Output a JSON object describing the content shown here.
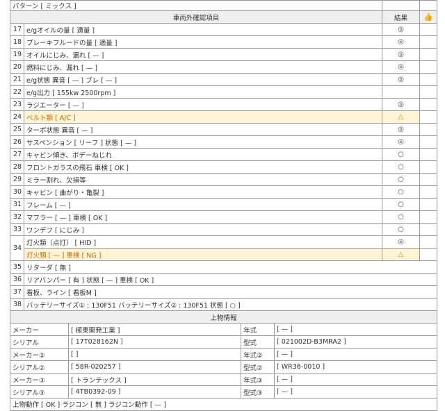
{
  "pattern_row": "パターン [ ミックス ]",
  "header": {
    "title": "車両外確認項目",
    "result_label": "結果",
    "icon": "thumb-up-icon"
  },
  "rows": [
    {
      "no": "17",
      "text": "e/gオイルの量 [ 適量 ]",
      "mark": "◎"
    },
    {
      "no": "18",
      "text": "ブレーキフルードの量 [ 適量 ]",
      "mark": "◎"
    },
    {
      "no": "19",
      "text": "オイルにじみ、漏れ [ — ]",
      "mark": "◎"
    },
    {
      "no": "20",
      "text": "燃料にじみ、漏れ [ — ]",
      "mark": "◎"
    },
    {
      "no": "21",
      "text": "e/g状態  異音 [ — ]  ブレ [ — ]",
      "mark": "◎"
    },
    {
      "no": "22",
      "text": "e/g出力  [  155kw  2500rpm  ]",
      "mark": ""
    },
    {
      "no": "23",
      "text": "ラジエーター [ — ]",
      "mark": "◎"
    },
    {
      "no": "24",
      "text": "ベルト類 [ A/C ]",
      "mark": "△",
      "highlight": true
    },
    {
      "no": "25",
      "text": "ターボ状態  異音 [ — ]",
      "mark": "◎"
    },
    {
      "no": "26",
      "text": "サスペンション [ リーフ ]  状態 [ — ]",
      "mark": "◎"
    },
    {
      "no": "27",
      "text": "キャビン傾き、ボデーねじれ",
      "mark": "○"
    },
    {
      "no": "28",
      "text": "フロントガラスの飛石   車検 [ OK ]",
      "mark": "○"
    },
    {
      "no": "29",
      "text": "ミラー割れ、欠損等",
      "mark": "○"
    },
    {
      "no": "30",
      "text": "キャビン [ 曲がり・亀裂 ]",
      "mark": "○"
    },
    {
      "no": "31",
      "text": "フレーム [ — ]",
      "mark": "○"
    },
    {
      "no": "32",
      "text": "マフラー [ — ]  車検 [ OK ]",
      "mark": "○"
    },
    {
      "no": "33",
      "text": "ワンデフ [ にじみ ]",
      "mark": "○"
    }
  ],
  "row34": {
    "no": "34",
    "a": {
      "text": "灯火類（点灯） [ HID ]",
      "mark": "◎"
    },
    "b": {
      "text": "灯火類 [ — ]  車検 [ NG ]",
      "mark": "△"
    }
  },
  "rows2": [
    {
      "no": "35",
      "text": "リターダ [ 無 ]"
    },
    {
      "no": "36",
      "text": "リアバンパー [ 有 ]  状態 [ — ]  車検 [ OK ]"
    },
    {
      "no": "37",
      "text": "看板、ライン [ 看板M ]"
    },
    {
      "no": "38",
      "text": "バッテリーサイズ① : 130F51  バッテリーサイズ② : 130F51  状態 [ ○ ]"
    }
  ],
  "equip": {
    "title": "上物情報",
    "rows": [
      {
        "l": "メーカー",
        "lv": "[ 極東開発工業 ]",
        "r": "年式",
        "rv": "[ — ]"
      },
      {
        "l": "シリアル",
        "lv": "[ 17T028162N ]",
        "r": "型式",
        "rv": "[ 021002D-B3MRA2 ]"
      },
      {
        "l": "メーカー②",
        "lv": "[ ]",
        "r": "年式②",
        "rv": "[ — ]"
      },
      {
        "l": "シリアル②",
        "lv": "[ 58R-020257 ]",
        "r": "型式②",
        "rv": "[ WR36-0010 ]"
      },
      {
        "l": "メーカー③",
        "lv": "[ トランテックス ]",
        "r": "年式③",
        "rv": "[ — ]"
      },
      {
        "l": "シリアル③",
        "lv": "[ 4TB0392-09 ]",
        "r": "型式③",
        "rv": "[ — ]"
      }
    ],
    "footer": "上物動作 [ OK ]  ラジコン [ 無 ]  ラジコン動作 [ — ]"
  }
}
